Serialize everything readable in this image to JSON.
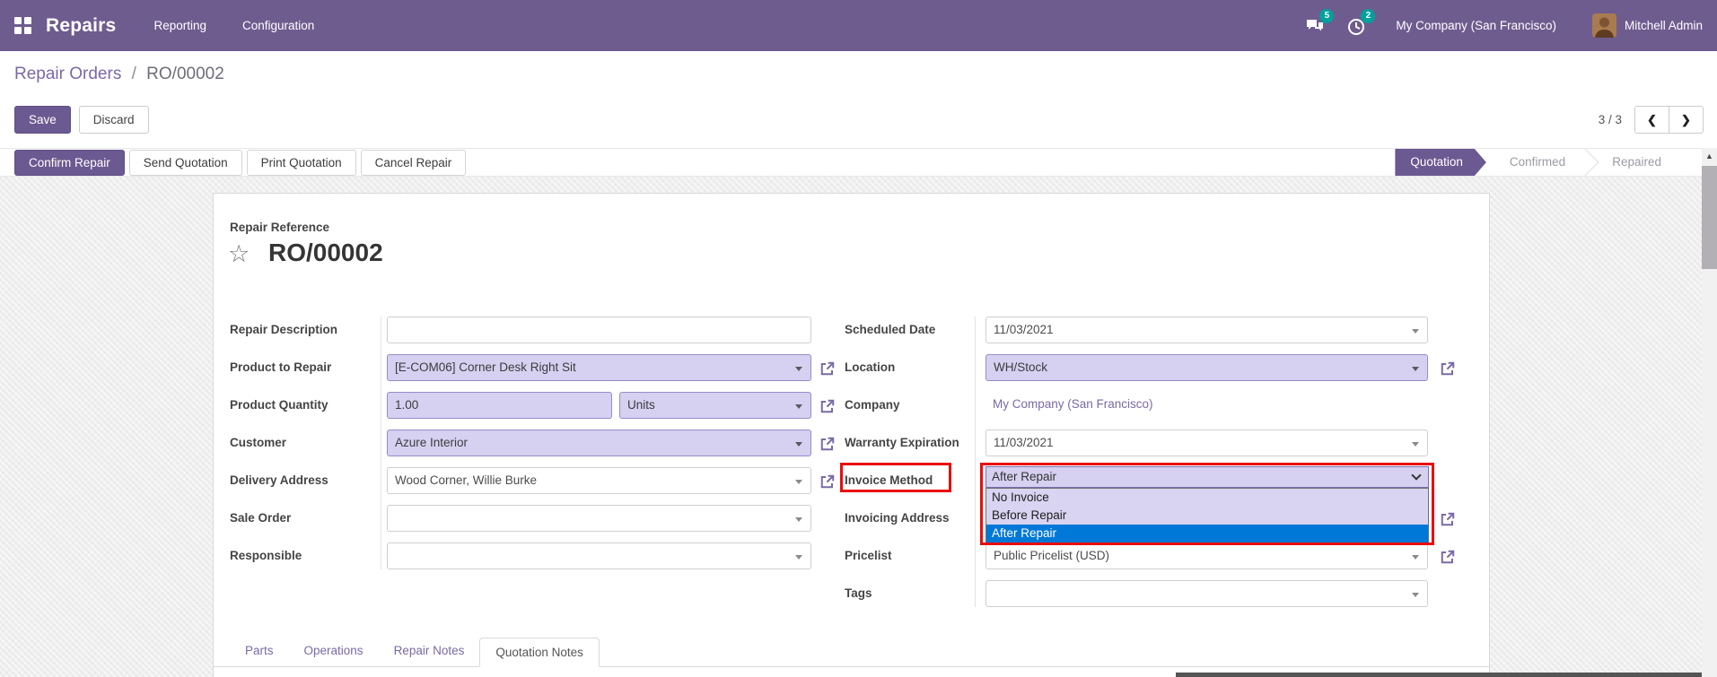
{
  "navbar": {
    "app_name": "Repairs",
    "menu_items": [
      {
        "label": "Reporting"
      },
      {
        "label": "Configuration"
      }
    ],
    "messages_count": "5",
    "activities_count": "2",
    "company_name": "My Company (San Francisco)",
    "user_name": "Mitchell Admin"
  },
  "control_panel": {
    "breadcrumb": {
      "parent": "Repair Orders",
      "separator": "/",
      "current": "RO/00002"
    },
    "save": "Save",
    "discard": "Discard",
    "pager_text": "3 / 3"
  },
  "actions": {
    "confirm": "Confirm Repair",
    "send": "Send Quotation",
    "print": "Print Quotation",
    "cancel": "Cancel Repair"
  },
  "statusbar": {
    "steps": [
      {
        "label": "Quotation",
        "active": true
      },
      {
        "label": "Confirmed",
        "active": false
      },
      {
        "label": "Repaired",
        "active": false
      }
    ]
  },
  "form": {
    "reference_label": "Repair Reference",
    "reference": "RO/00002",
    "fields": {
      "repair_description": {
        "label": "Repair Description",
        "value": ""
      },
      "product_to_repair": {
        "label": "Product to Repair",
        "value": "[E-COM06] Corner Desk Right Sit"
      },
      "product_quantity": {
        "label": "Product Quantity",
        "value": "1.00",
        "uom": "Units"
      },
      "customer": {
        "label": "Customer",
        "value": "Azure Interior"
      },
      "delivery_address": {
        "label": "Delivery Address",
        "value": "Wood Corner, Willie Burke"
      },
      "sale_order": {
        "label": "Sale Order",
        "value": ""
      },
      "responsible": {
        "label": "Responsible",
        "value": ""
      },
      "scheduled_date": {
        "label": "Scheduled Date",
        "value": "11/03/2021"
      },
      "location": {
        "label": "Location",
        "value": "WH/Stock"
      },
      "company": {
        "label": "Company",
        "value": "My Company (San Francisco)"
      },
      "warranty_expiration": {
        "label": "Warranty Expiration",
        "value": "11/03/2021"
      },
      "invoice_method": {
        "label": "Invoice Method",
        "selected": "After Repair",
        "options": [
          "No Invoice",
          "Before Repair",
          "After Repair"
        ],
        "highlighted": "After Repair"
      },
      "invoicing_address": {
        "label": "Invoicing Address"
      },
      "pricelist": {
        "label": "Pricelist",
        "value": "Public Pricelist (USD)"
      },
      "tags": {
        "label": "Tags",
        "value": ""
      }
    }
  },
  "tabs": [
    {
      "label": "Parts",
      "active": false
    },
    {
      "label": "Operations",
      "active": false
    },
    {
      "label": "Repair Notes",
      "active": false
    },
    {
      "label": "Quotation Notes",
      "active": true
    }
  ],
  "icons": {
    "favorite_star": "☆",
    "pager_previous": "❮",
    "pager_next": "❯",
    "scroll_up": "▲"
  },
  "colors": {
    "navbar": "#6e5c8f",
    "primary": "#6b5991",
    "required_field_bg": "#d6d0f1",
    "highlight_red": "#e90d0d",
    "selected_option_bg": "#0078d7",
    "badge": "#00a09d",
    "link": "#7a6aa5"
  }
}
